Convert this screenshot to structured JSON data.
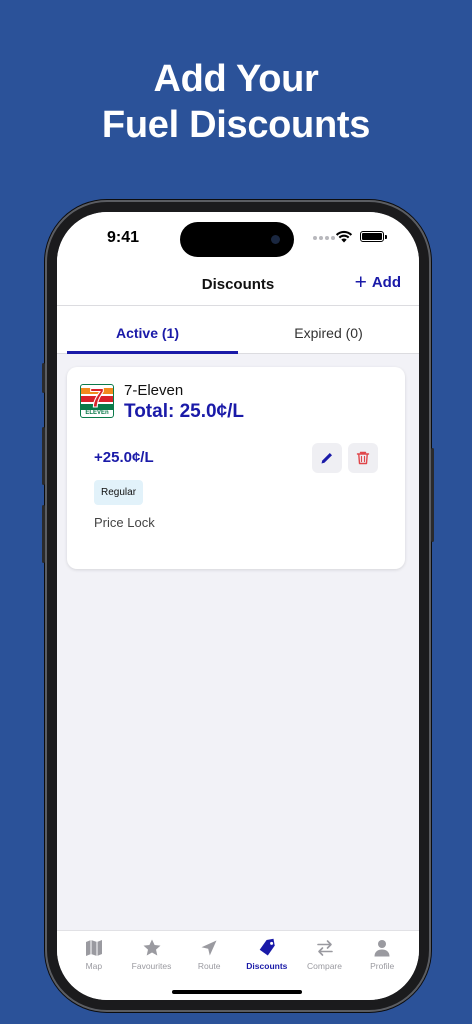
{
  "headline": {
    "line1": "Add Your",
    "line2": "Fuel Discounts"
  },
  "status_bar": {
    "time": "9:41"
  },
  "nav": {
    "title": "Discounts",
    "add_label": "Add"
  },
  "tabs": [
    {
      "label": "Active (1)",
      "active": true
    },
    {
      "label": "Expired (0)",
      "active": false
    }
  ],
  "discount_card": {
    "station": "7-Eleven",
    "logo_text": "7",
    "logo_word": "ELEVEn",
    "total": "Total: 25.0¢/L",
    "amount": "+25.0¢/L",
    "fuel_type": "Regular",
    "discount_type": "Price Lock"
  },
  "tab_bar": [
    {
      "label": "Map",
      "icon": "map-icon",
      "active": false
    },
    {
      "label": "Favourites",
      "icon": "star-icon",
      "active": false
    },
    {
      "label": "Route",
      "icon": "navigation-arrow-icon",
      "active": false
    },
    {
      "label": "Discounts",
      "icon": "tag-icon",
      "active": true
    },
    {
      "label": "Compare",
      "icon": "swap-arrows-icon",
      "active": false
    },
    {
      "label": "Profile",
      "icon": "person-icon",
      "active": false
    }
  ],
  "colors": {
    "background": "#2b5299",
    "accent": "#1a1aa8",
    "delete": "#e0464a"
  }
}
